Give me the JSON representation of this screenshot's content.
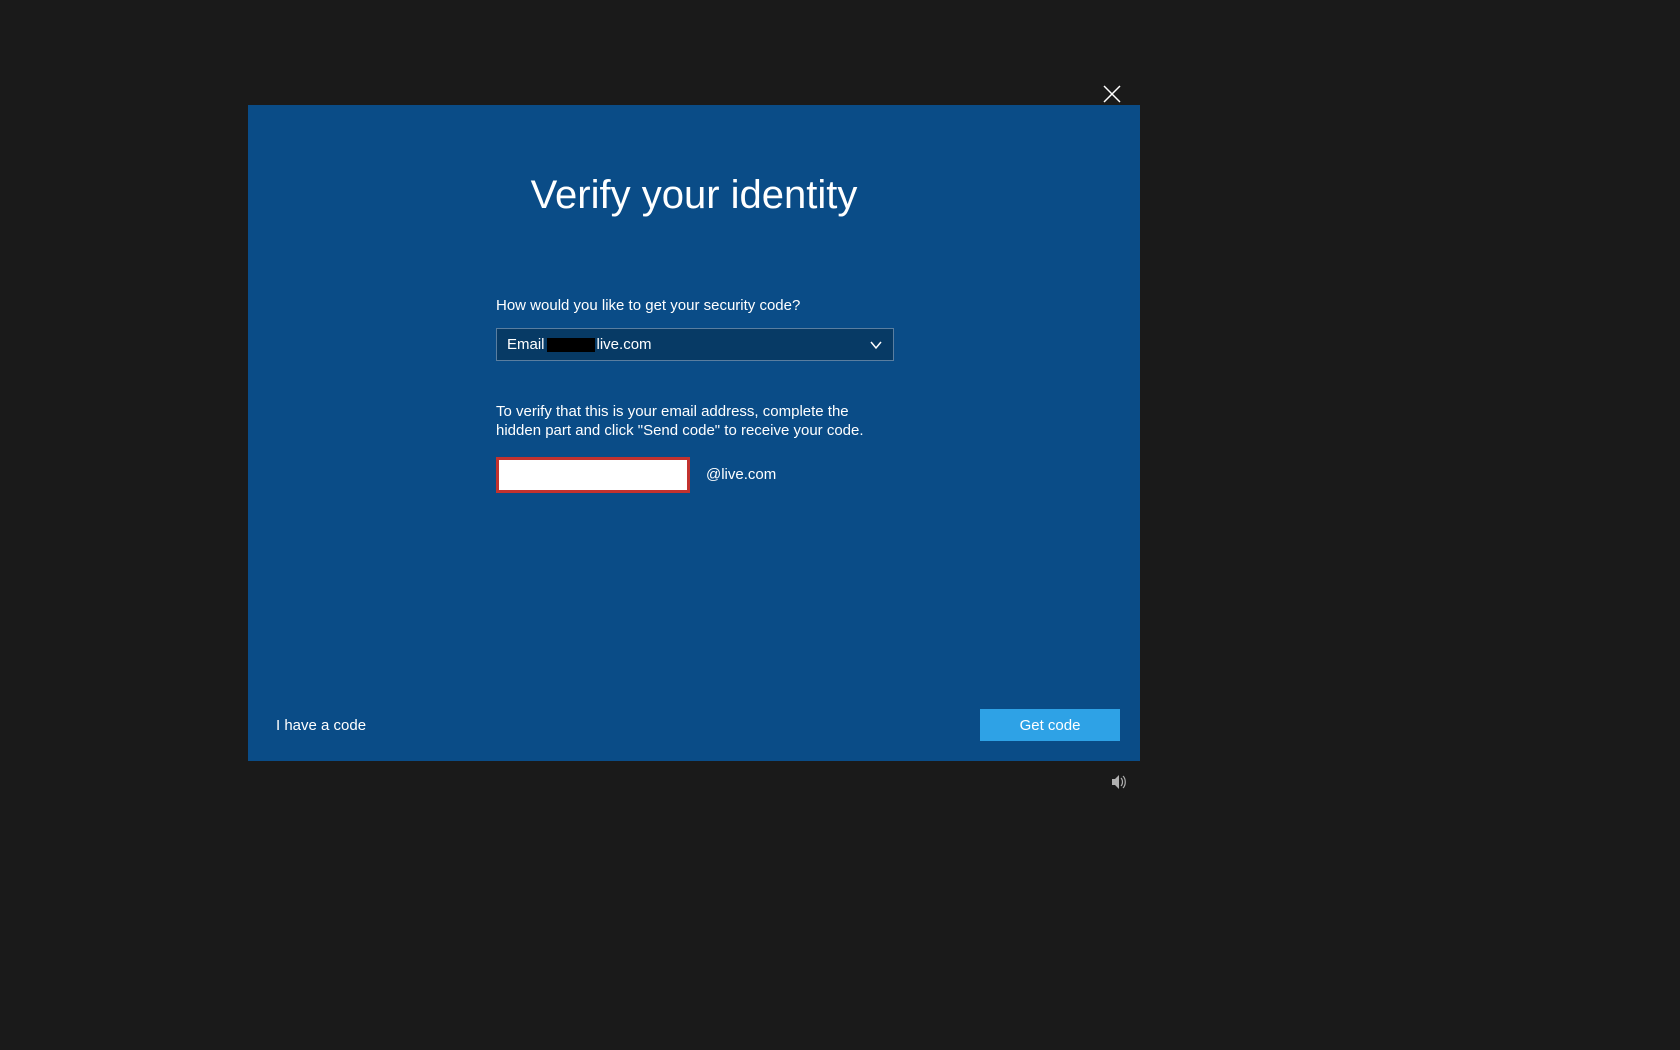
{
  "dialog": {
    "title": "Verify your identity",
    "prompt": "How would you like to get your security code?",
    "method": {
      "prefix": "Email ",
      "suffix": "live.com"
    },
    "instruction": "To verify that this is your email address, complete the hidden part and click \"Send code\" to receive your code.",
    "email_input_value": "",
    "domain_suffix": "@live.com",
    "have_code_link": "I have a code",
    "get_code_button": "Get code"
  }
}
